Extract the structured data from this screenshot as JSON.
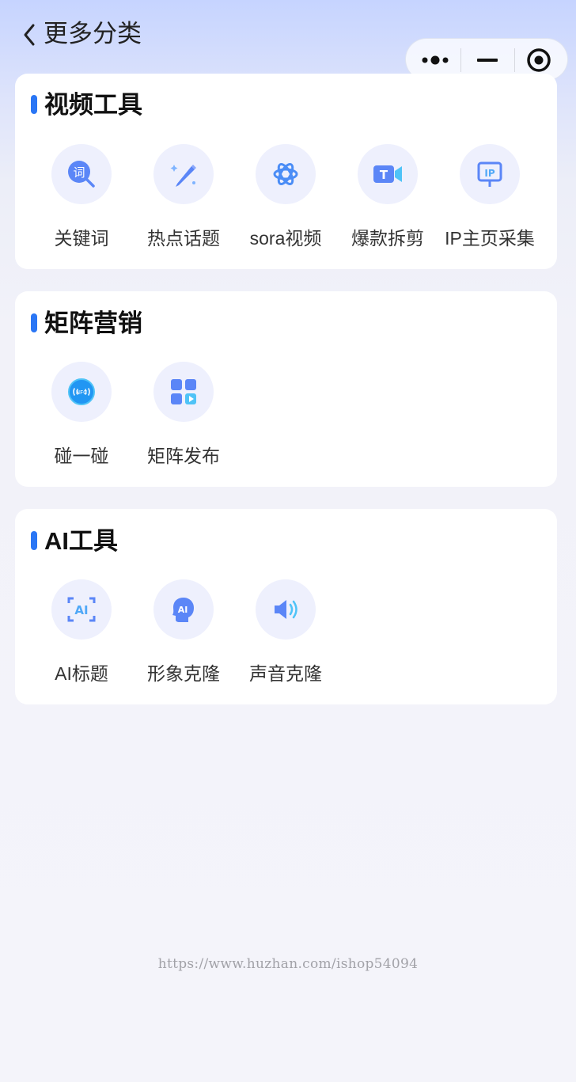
{
  "header": {
    "title": "更多分类"
  },
  "sections": [
    {
      "title": "视频工具",
      "items": [
        {
          "label": "关键词",
          "icon": "keyword-search-icon"
        },
        {
          "label": "热点话题",
          "icon": "sparkle-pen-icon"
        },
        {
          "label": "sora视频",
          "icon": "sora-logo-icon"
        },
        {
          "label": "爆款拆剪",
          "icon": "video-camera-icon"
        },
        {
          "label": "IP主页采集",
          "icon": "ip-board-icon"
        }
      ]
    },
    {
      "title": "矩阵营销",
      "items": [
        {
          "label": "碰一碰",
          "icon": "nfc-icon"
        },
        {
          "label": "矩阵发布",
          "icon": "grid-video-icon"
        }
      ]
    },
    {
      "title": "AI工具",
      "items": [
        {
          "label": "AI标题",
          "icon": "ai-frame-icon"
        },
        {
          "label": "形象克隆",
          "icon": "ai-head-icon"
        },
        {
          "label": "声音克隆",
          "icon": "speaker-icon"
        }
      ]
    }
  ],
  "watermark": "https://www.huzhan.com/ishop54094",
  "colors": {
    "accent": "#2a76f5",
    "icon_blue": "#5b86f7",
    "icon_bg": "#eef0fd"
  }
}
